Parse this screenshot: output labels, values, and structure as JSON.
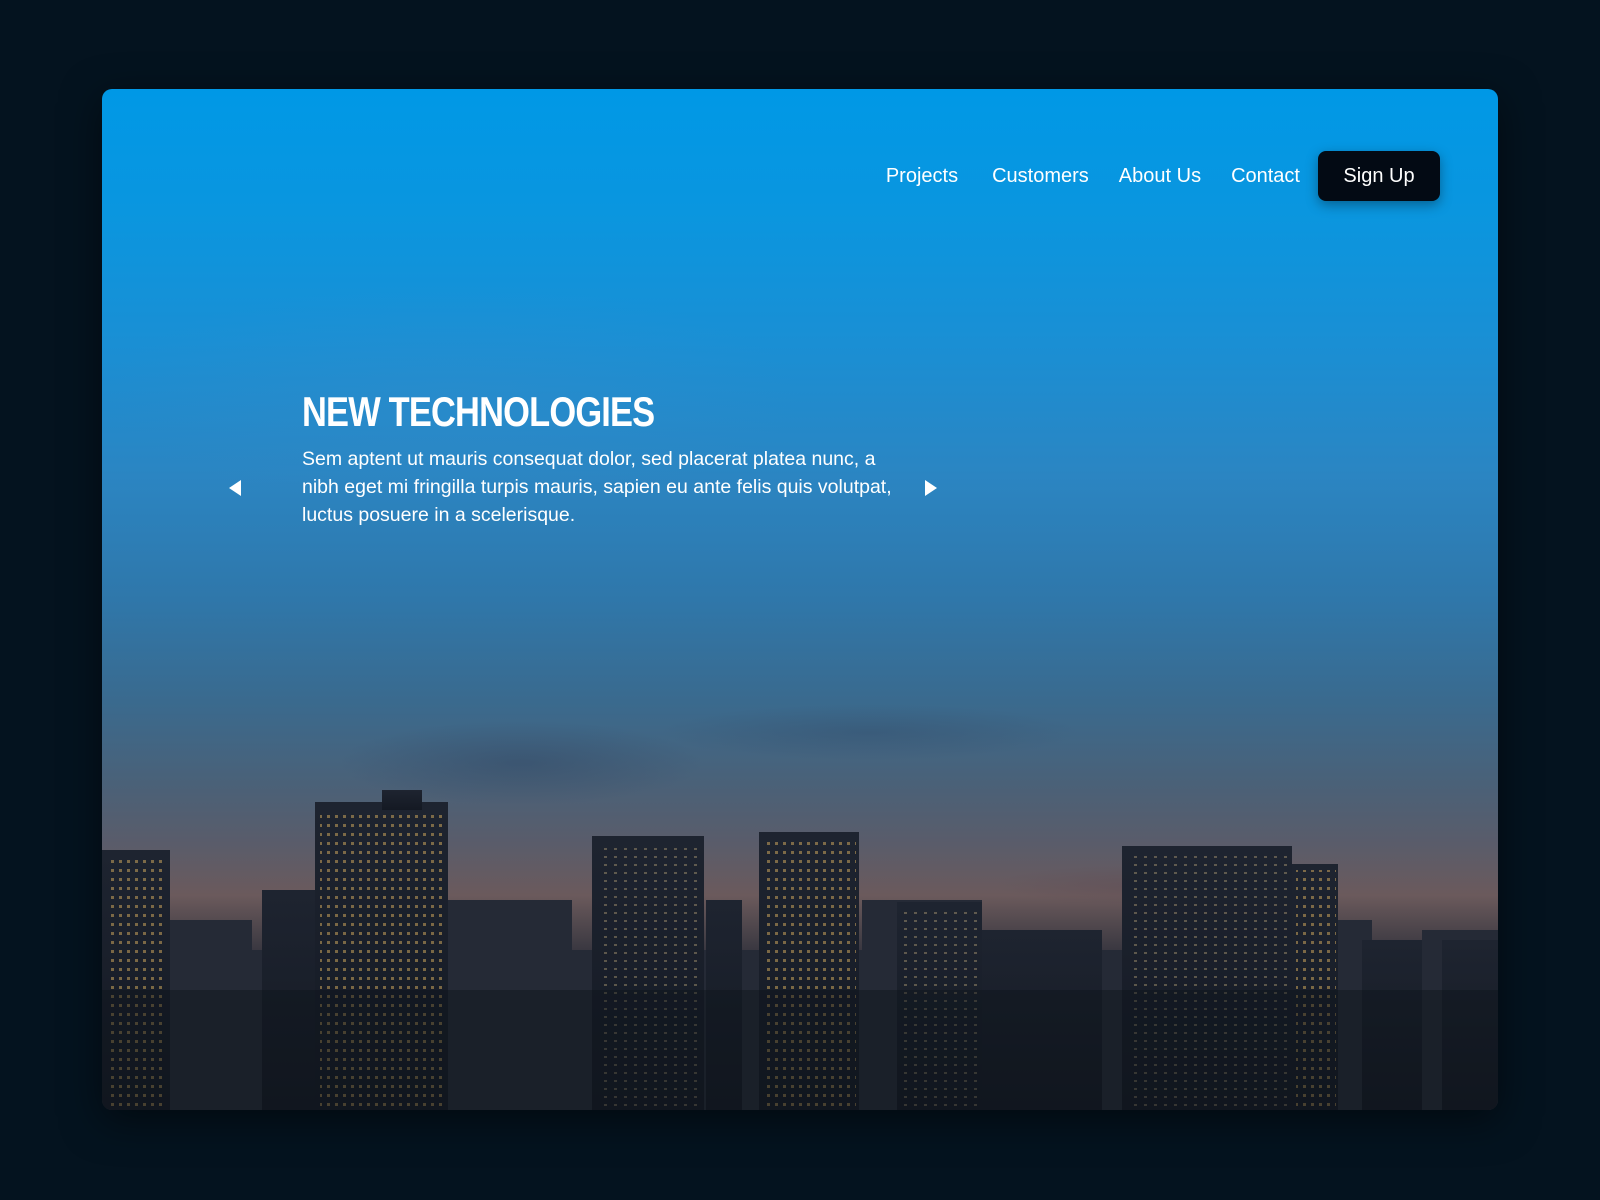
{
  "nav": {
    "links": [
      "Projects",
      "Customers",
      "About Us",
      "Contact"
    ],
    "signup_label": "Sign Up"
  },
  "slide": {
    "title": "New Technologies",
    "text": "Sem aptent ut mauris consequat dolor, sed placerat platea nunc, a nibh eget mi fringilla turpis mauris, sapien eu ante felis quis volutpat, luctus posuere in a scelerisque."
  },
  "icons": {
    "prev": "arrow-left-icon",
    "next": "arrow-right-icon"
  },
  "colors": {
    "page_background": "#04131f",
    "sky_top": "#0098e6",
    "signup_button": "#030a14",
    "text": "#ffffff"
  }
}
